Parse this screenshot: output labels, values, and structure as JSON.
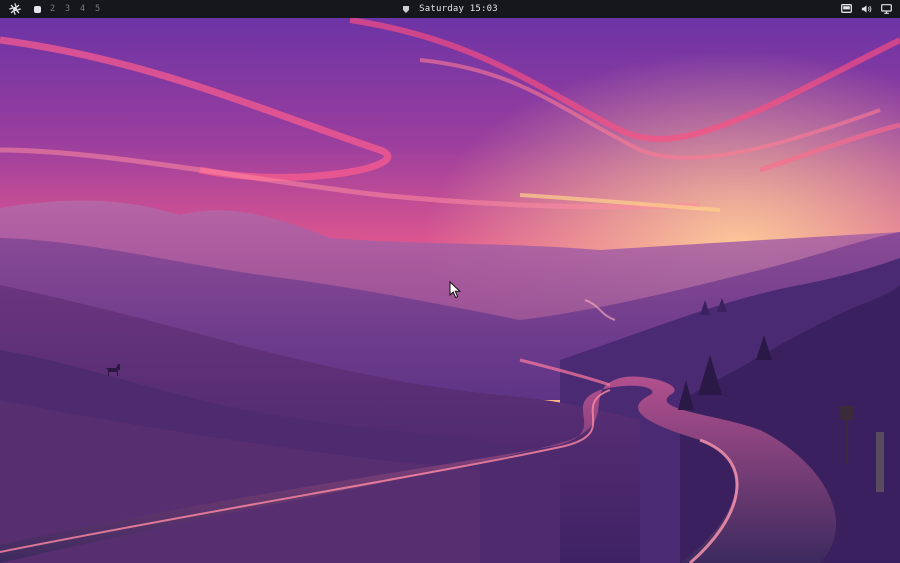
{
  "topbar": {
    "launcher_icon": "launcher-icon",
    "workspaces": [
      {
        "label": "1",
        "active": true
      },
      {
        "label": "2",
        "active": false
      },
      {
        "label": "3",
        "active": false
      },
      {
        "label": "4",
        "active": false
      },
      {
        "label": "5",
        "active": false
      }
    ],
    "clock": "Saturday 15:03",
    "tray_icons": [
      "display-icon",
      "volume-icon",
      "monitor-icon"
    ]
  },
  "colors": {
    "bar_bg": "#16161d",
    "sky_top": "#6a3aa8",
    "sky_horizon": "#ffb07a",
    "hills": "#5a2f82",
    "road": "#3a2a5a",
    "road_glow": "#ff6a7a"
  }
}
